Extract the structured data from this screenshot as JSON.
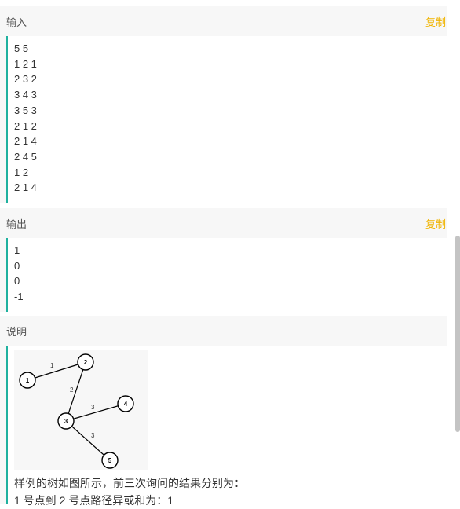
{
  "input_section": {
    "title": "输入",
    "copy_label": "复制",
    "lines": [
      "5 5",
      "1 2 1",
      "2 3 2",
      "3 4 3",
      "3 5 3",
      "2 1 2",
      "2 1 4",
      "2 4 5",
      "1 2",
      "2 1 4"
    ]
  },
  "output_section": {
    "title": "输出",
    "copy_label": "复制",
    "lines": [
      "1",
      "0",
      "0",
      "-1"
    ]
  },
  "description": {
    "title": "说明",
    "tree": {
      "nodes": [
        "1",
        "2",
        "3",
        "4",
        "5"
      ],
      "edges": [
        {
          "from": "1",
          "to": "2",
          "weight": "1"
        },
        {
          "from": "2",
          "to": "3",
          "weight": "2"
        },
        {
          "from": "3",
          "to": "4",
          "weight": "3"
        },
        {
          "from": "3",
          "to": "5",
          "weight": "3"
        }
      ]
    },
    "text_lines": [
      "样例的树如图所示，前三次询问的结果分别为：",
      "1 号点到 2 号点路径异或和为：1"
    ]
  },
  "colors": {
    "accent_bar": "#1fb19f",
    "copy_link": "#f0b400",
    "panel_bg": "#f7f7f7"
  }
}
